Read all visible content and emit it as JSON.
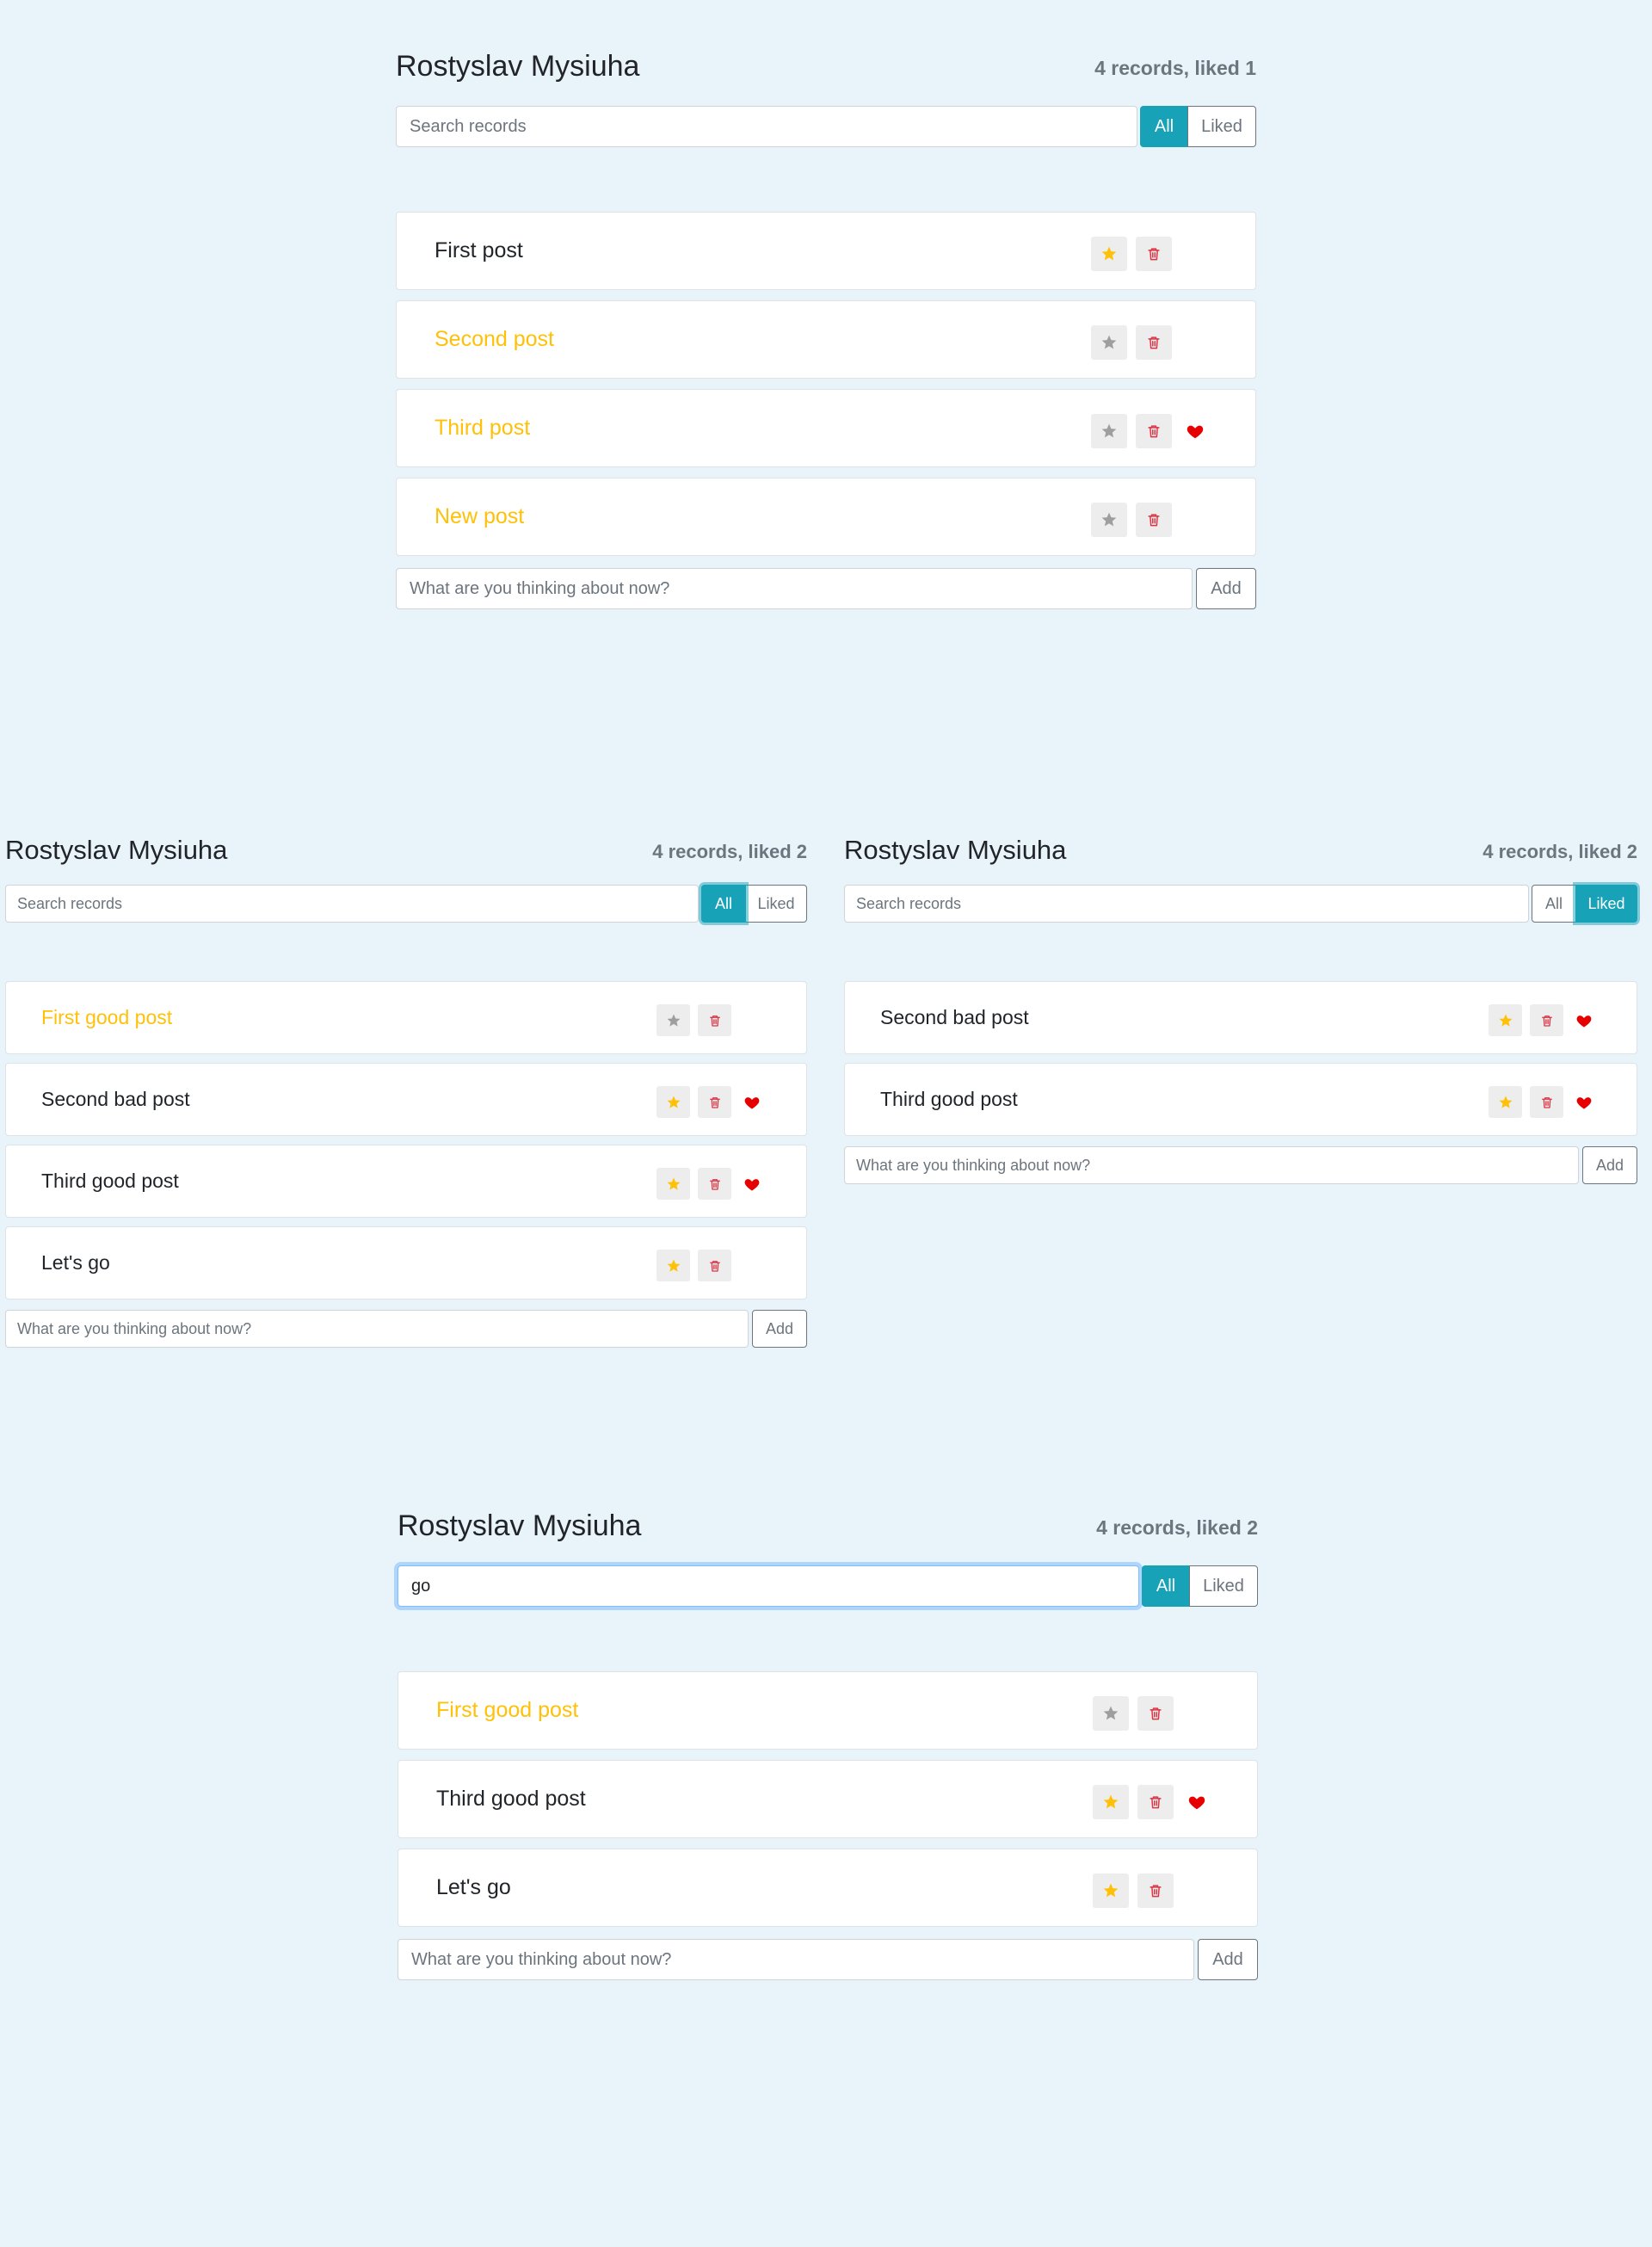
{
  "colors": {
    "background": "#e9f3fa",
    "accent": "#17a2b8",
    "star_active": "#ffc107",
    "star_inactive": "#9e9e9e",
    "trash": "#dc3545",
    "heart": "#e60000"
  },
  "icons": {
    "star": "star-icon",
    "trash": "trash-icon",
    "heart": "heart-icon"
  },
  "panels": [
    {
      "header": {
        "title": "Rostyslav Mysiuha",
        "count": "4 records, liked 1"
      },
      "search": {
        "placeholder": "Search records",
        "value": ""
      },
      "filter": {
        "all_label": "All",
        "liked_label": "Liked",
        "active": "All"
      },
      "posts": [
        {
          "label": "First post",
          "important": false,
          "liked": false
        },
        {
          "label": "Second post",
          "important": true,
          "liked": false
        },
        {
          "label": "Third post",
          "important": true,
          "liked": true
        },
        {
          "label": "New post",
          "important": true,
          "liked": false
        }
      ],
      "add_form": {
        "placeholder": "What are you thinking about now?",
        "button_label": "Add"
      }
    },
    {
      "header": {
        "title": "Rostyslav Mysiuha",
        "count": "4 records, liked 2"
      },
      "search": {
        "placeholder": "Search records",
        "value": ""
      },
      "filter": {
        "all_label": "All",
        "liked_label": "Liked",
        "active": "All"
      },
      "posts": [
        {
          "label": "First good post",
          "important": true,
          "liked": false
        },
        {
          "label": "Second bad post",
          "important": false,
          "liked": true
        },
        {
          "label": "Third good post",
          "important": false,
          "liked": true
        },
        {
          "label": "Let's go",
          "important": false,
          "liked": false
        }
      ],
      "add_form": {
        "placeholder": "What are you thinking about now?",
        "button_label": "Add"
      }
    },
    {
      "header": {
        "title": "Rostyslav Mysiuha",
        "count": "4 records, liked 2"
      },
      "search": {
        "placeholder": "Search records",
        "value": ""
      },
      "filter": {
        "all_label": "All",
        "liked_label": "Liked",
        "active": "Liked"
      },
      "posts": [
        {
          "label": "Second bad post",
          "important": false,
          "liked": true
        },
        {
          "label": "Third good post",
          "important": false,
          "liked": true
        }
      ],
      "add_form": {
        "placeholder": "What are you thinking about now?",
        "button_label": "Add"
      }
    },
    {
      "header": {
        "title": "Rostyslav Mysiuha",
        "count": "4 records, liked 2"
      },
      "search": {
        "placeholder": "Search records",
        "value": "go"
      },
      "filter": {
        "all_label": "All",
        "liked_label": "Liked",
        "active": "All"
      },
      "posts": [
        {
          "label": "First good post",
          "important": true,
          "liked": false
        },
        {
          "label": "Third good post",
          "important": false,
          "liked": true
        },
        {
          "label": "Let's go",
          "important": false,
          "liked": false
        }
      ],
      "add_form": {
        "placeholder": "What are you thinking about now?",
        "button_label": "Add"
      }
    }
  ]
}
